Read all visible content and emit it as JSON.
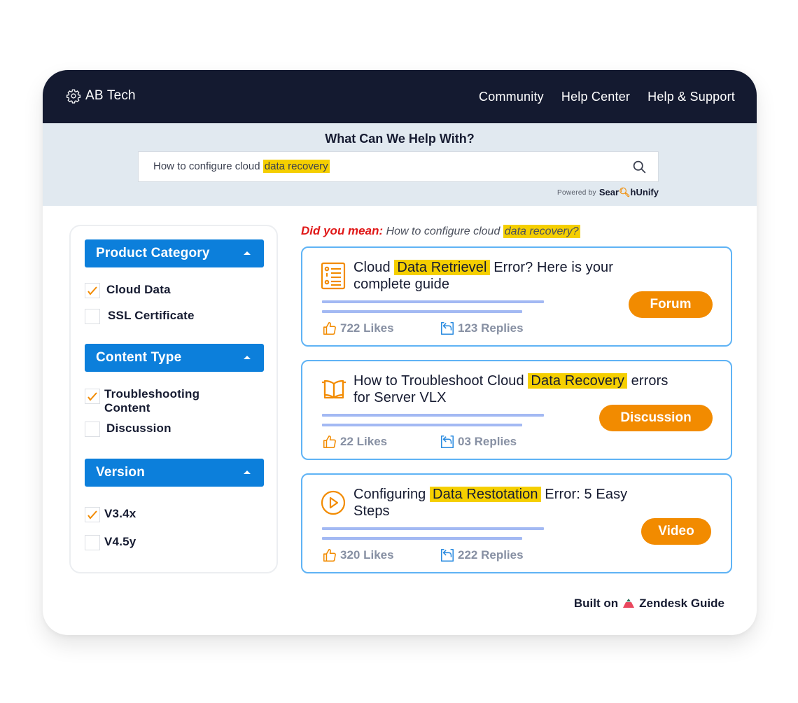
{
  "navbar": {
    "brand": "AB Tech",
    "brand_icon": "gear-icon",
    "links": [
      "Community",
      "Help Center",
      "Help & Support"
    ]
  },
  "search": {
    "title": "What Can We Help With?",
    "query_prefix": "How to configure cloud ",
    "query_highlight": "data recovery",
    "search_icon": "search-icon",
    "powered_by": "Powered by",
    "powered_brand_a": "Sear",
    "powered_brand_b": "hUnify"
  },
  "filters": [
    {
      "title": "Product Category",
      "expanded": true,
      "options": [
        {
          "label": "Cloud Data",
          "checked": true
        },
        {
          "label": "SSL Certificate",
          "checked": false
        }
      ]
    },
    {
      "title": "Content Type",
      "expanded": true,
      "options": [
        {
          "label": "Troubleshooting Content",
          "checked": true
        },
        {
          "label": "Discussion",
          "checked": false
        }
      ]
    },
    {
      "title": "Version",
      "expanded": true,
      "options": [
        {
          "label": "V3.4x",
          "checked": true
        },
        {
          "label": "V4.5y",
          "checked": false
        }
      ]
    }
  ],
  "did_you_mean": {
    "label": "Did you mean:",
    "query_prefix": "How to configure cloud ",
    "query_highlight": "data recovery?"
  },
  "results": [
    {
      "icon": "document-list-icon",
      "title_before": "Cloud ",
      "title_highlight": "Data Retrievel",
      "title_after": " Error? Here is your complete guide",
      "likes": "722 Likes",
      "replies": "123 Replies",
      "type": "Forum"
    },
    {
      "icon": "book-open-icon",
      "title_before": "How to Troubleshoot Cloud ",
      "title_highlight": "Data Recovery",
      "title_after": " errors for Server VLX",
      "likes": "22 Likes",
      "replies": "03 Replies",
      "type": "Discussion"
    },
    {
      "icon": "play-circle-icon",
      "title_before": "Configuring ",
      "title_highlight": "Data Restotation",
      "title_after": " Error: 5 Easy Steps",
      "likes": "320 Likes",
      "replies": "222 Replies",
      "type": "Video"
    }
  ],
  "footer": {
    "prefix": "Built on",
    "brand": "Zendesk Guide"
  },
  "colors": {
    "navbar": "#141a30",
    "accent_blue": "#0c7fdb",
    "accent_orange": "#f28b00",
    "highlight": "#f5cf00",
    "card_border": "#5fb3f5",
    "dym_red": "#e01818"
  }
}
